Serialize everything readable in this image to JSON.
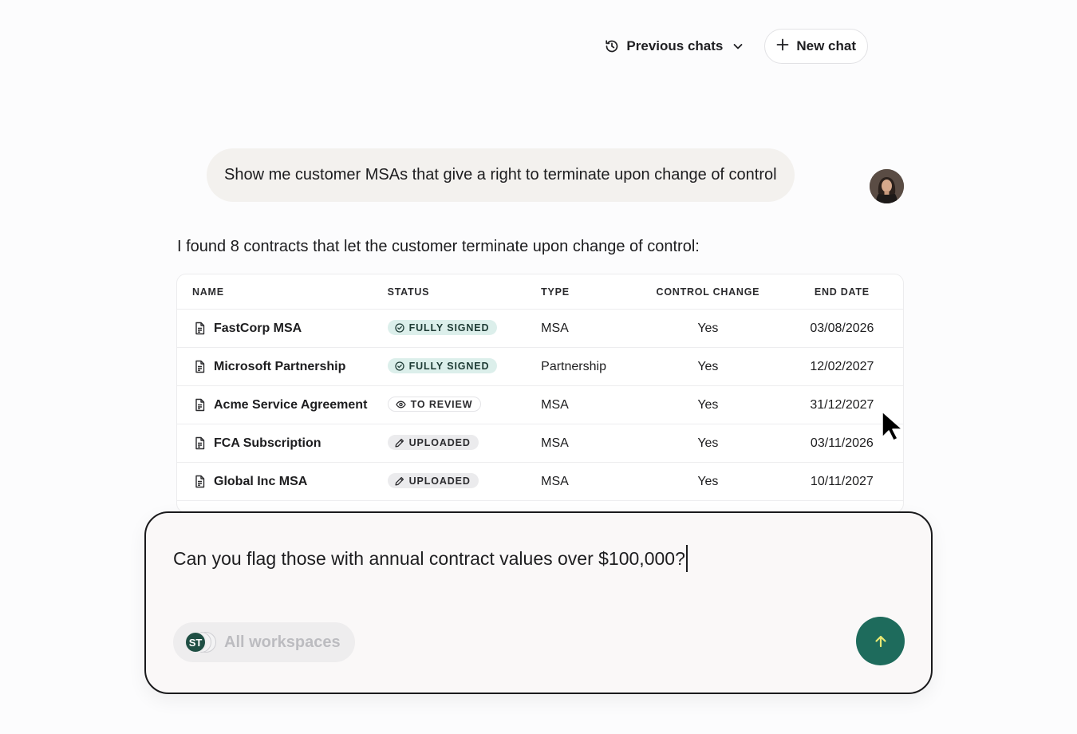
{
  "header": {
    "previous_chats_label": "Previous chats",
    "new_chat_label": "New chat"
  },
  "conversation": {
    "user_message": "Show me customer MSAs that give a right to terminate upon change of control",
    "assistant_intro": "I found 8 contracts that let the customer terminate upon change of control:"
  },
  "table": {
    "columns": [
      "NAME",
      "STATUS",
      "TYPE",
      "CONTROL CHANGE",
      "END DATE"
    ],
    "rows": [
      {
        "name": "FastCorp MSA",
        "status": "FULLY SIGNED",
        "type": "MSA",
        "control_change": "Yes",
        "end_date": "03/08/2026"
      },
      {
        "name": "Microsoft Partnership",
        "status": "FULLY SIGNED",
        "type": "Partnership",
        "control_change": "Yes",
        "end_date": "12/02/2027"
      },
      {
        "name": "Acme Service Agreement",
        "status": "TO REVIEW",
        "type": "MSA",
        "control_change": "Yes",
        "end_date": "31/12/2027"
      },
      {
        "name": "FCA Subscription",
        "status": "UPLOADED",
        "type": "MSA",
        "control_change": "Yes",
        "end_date": "03/11/2026"
      },
      {
        "name": "Global Inc MSA",
        "status": "UPLOADED",
        "type": "MSA",
        "control_change": "Yes",
        "end_date": "10/11/2027"
      }
    ]
  },
  "composer": {
    "input_value": "Can you flag those with annual contract values over $100,000?",
    "workspace_initials": "ST",
    "workspace_label": "All workspaces"
  },
  "colors": {
    "accent": "#1e6b5c",
    "signed_badge": "#dcefeb",
    "user_bubble": "#f3f1ee"
  },
  "icons": {
    "previous_chats": "history-icon",
    "dropdown": "chevron-down-icon",
    "new_chat": "plus-icon",
    "document": "document-icon",
    "signed": "check-circle-icon",
    "review": "eye-icon",
    "uploaded": "pencil-icon",
    "send": "arrow-up-icon"
  }
}
